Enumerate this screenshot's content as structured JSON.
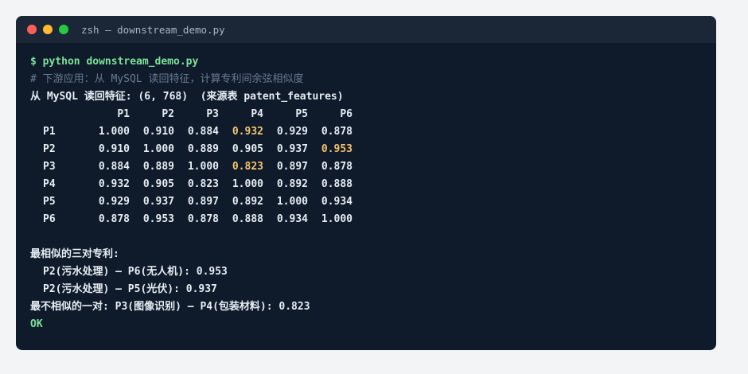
{
  "window": {
    "title": "zsh — downstream_demo.py"
  },
  "terminal": {
    "command": "$ python downstream_demo.py",
    "comment": "# 下游应用：从 MySQL 读回特征，计算专利间余弦相似度",
    "read_line": "从 MySQL 读回特征: (6, 768)  (来源表 patent_features)",
    "matrix": {
      "columns": [
        "P1",
        "P2",
        "P3",
        "P4",
        "P5",
        "P6"
      ],
      "rows": [
        {
          "label": "P1",
          "values": [
            "1.000",
            "0.910",
            "0.884",
            "0.932",
            "0.929",
            "0.878"
          ]
        },
        {
          "label": "P2",
          "values": [
            "0.910",
            "1.000",
            "0.889",
            "0.905",
            "0.937",
            "0.953"
          ]
        },
        {
          "label": "P3",
          "values": [
            "0.884",
            "0.889",
            "1.000",
            "0.823",
            "0.897",
            "0.878"
          ]
        },
        {
          "label": "P4",
          "values": [
            "0.932",
            "0.905",
            "0.823",
            "1.000",
            "0.892",
            "0.888"
          ]
        },
        {
          "label": "P5",
          "values": [
            "0.929",
            "0.937",
            "0.897",
            "0.892",
            "1.000",
            "0.934"
          ]
        },
        {
          "label": "P6",
          "values": [
            "0.878",
            "0.953",
            "0.878",
            "0.888",
            "0.934",
            "1.000"
          ]
        }
      ],
      "highlights": [
        [
          0,
          3
        ],
        [
          1,
          5
        ],
        [
          2,
          3
        ]
      ],
      "highlight_color": "#f5c46b"
    },
    "top3_header": "最相似的三对专利:",
    "top_pairs": [
      "P2(污水处理) — P6(无人机): 0.953",
      "P2(污水处理) — P5(光伏): 0.937"
    ],
    "least_similar": "最不相似的一对: P3(图像识别) — P4(包装材料): 0.823",
    "status": "OK"
  },
  "colors": {
    "background": "#0f1a2b",
    "titlebar": "#1b2636",
    "prompt_green": "#7ee29a",
    "comment_gray": "#6b7b8f",
    "text": "#e6edf3"
  }
}
